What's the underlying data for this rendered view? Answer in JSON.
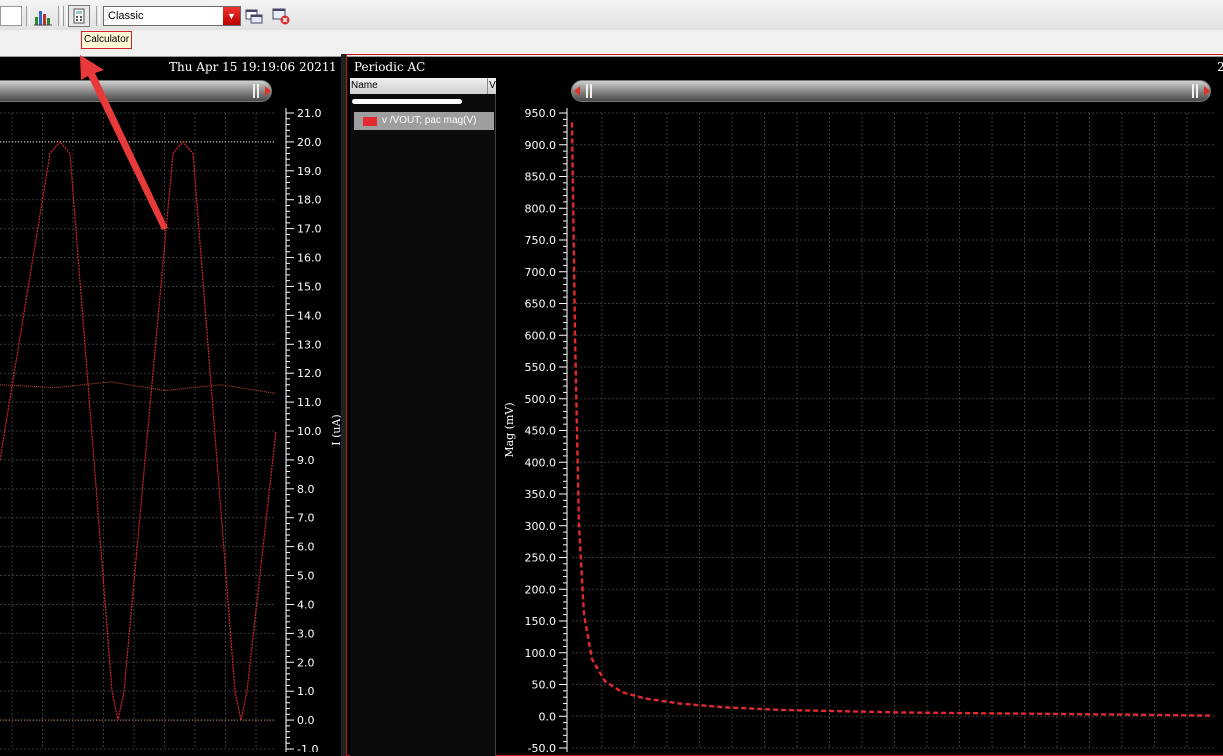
{
  "toolbar": {
    "plot_style_value": "Classic",
    "tooltip": "Calculator"
  },
  "left_pane": {
    "timestamp": "Thu Apr 15 19:19:06 2021",
    "page_number": "1",
    "y_axis_label": "I (uA)",
    "trace_color": "#d8262c"
  },
  "right_pane": {
    "title": "Periodic AC",
    "page_number": "2",
    "legend": {
      "header_name": "Name",
      "header_vis": "V",
      "trace_name": "v /VOUT; pac mag(V)",
      "trace_color": "#e3292e"
    },
    "y_axis_label": "Mag (mV)"
  },
  "chart_data": [
    {
      "type": "line",
      "title": "",
      "ylabel": "I (uA)",
      "ylim": [
        -1.0,
        21.0
      ],
      "y_ticks": [
        "21.0",
        "20.0",
        "19.0",
        "18.0",
        "17.0",
        "16.0",
        "15.0",
        "14.0",
        "13.0",
        "12.0",
        "11.0",
        "10.0",
        "9.0",
        "8.0",
        "7.0",
        "6.0",
        "5.0",
        "4.0",
        "3.0",
        "2.0",
        "1.0",
        "0.0",
        "-1.0"
      ],
      "grid": true,
      "series": [
        {
          "values": [
            11.6,
            11.5,
            11.7,
            11.4,
            11.6,
            11.3
          ]
        },
        {
          "values": [
            20.0,
            20.0,
            20.0,
            20.0,
            20.0,
            20.0
          ]
        },
        {
          "values": [
            0.0,
            0.0,
            0.0,
            0.0,
            0.0,
            0.0
          ]
        },
        {
          "values": [
            9.0,
            20.0,
            0.0,
            20.0,
            0.0,
            10.0
          ]
        }
      ]
    },
    {
      "type": "line",
      "title": "",
      "ylabel": "Mag (mV)",
      "ylim": [
        -50.0,
        950.0
      ],
      "y_ticks": [
        "950.0",
        "900.0",
        "850.0",
        "800.0",
        "750.0",
        "700.0",
        "650.0",
        "600.0",
        "550.0",
        "500.0",
        "450.0",
        "400.0",
        "350.0",
        "300.0",
        "250.0",
        "200.0",
        "150.0",
        "100.0",
        "50.0",
        "0.0",
        "-50.0"
      ],
      "grid": true,
      "series": [
        {
          "name": "v /VOUT; pac mag(V)",
          "values": [
            935,
            600,
            300,
            160,
            90,
            55,
            38,
            28,
            20,
            14,
            10,
            8,
            6,
            5,
            4,
            3,
            2,
            1
          ]
        }
      ]
    }
  ]
}
